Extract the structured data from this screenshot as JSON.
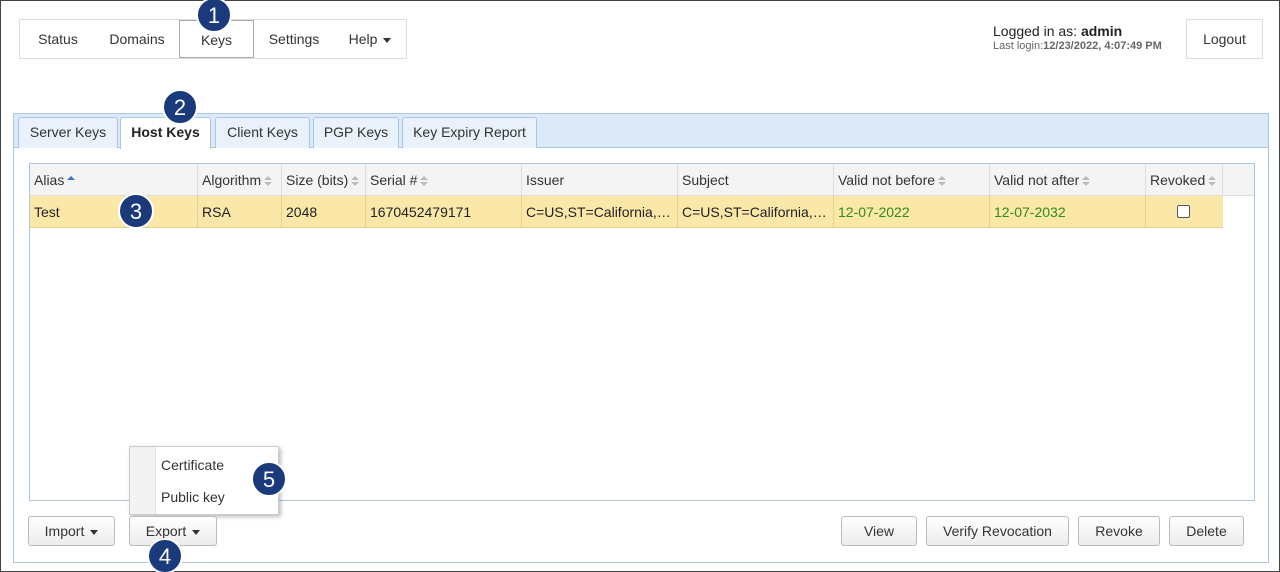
{
  "nav": {
    "items": [
      {
        "label": "Status"
      },
      {
        "label": "Domains"
      },
      {
        "label": "Keys"
      },
      {
        "label": "Settings"
      },
      {
        "label": "Help"
      }
    ]
  },
  "session": {
    "logged_in_prefix": "Logged in as: ",
    "user": "admin",
    "last_login_prefix": "Last login:",
    "last_login": "12/23/2022, 4:07:49 PM",
    "logout_label": "Logout"
  },
  "tabs": [
    {
      "label": "Server Keys"
    },
    {
      "label": "Host Keys"
    },
    {
      "label": "Client Keys"
    },
    {
      "label": "PGP Keys"
    },
    {
      "label": "Key Expiry Report"
    }
  ],
  "table": {
    "columns": [
      {
        "label": "Alias"
      },
      {
        "label": "Algorithm"
      },
      {
        "label": "Size (bits)"
      },
      {
        "label": "Serial #"
      },
      {
        "label": "Issuer"
      },
      {
        "label": "Subject"
      },
      {
        "label": "Valid not before"
      },
      {
        "label": "Valid not after"
      },
      {
        "label": "Revoked"
      }
    ],
    "rows": [
      {
        "alias": "Test",
        "algorithm": "RSA",
        "size": "2048",
        "serial": "1670452479171",
        "issuer": "C=US,ST=California,L=San Jose",
        "subject": "C=US,ST=California,L=San Jose",
        "valid_not_before": "12-07-2022",
        "valid_not_after": "12-07-2032",
        "revoked": false
      }
    ]
  },
  "export_menu": {
    "items": [
      {
        "label": "Certificate"
      },
      {
        "label": "Public key"
      }
    ]
  },
  "buttons": {
    "import": "Import",
    "export": "Export",
    "view": "View",
    "verify_revocation": "Verify Revocation",
    "revoke": "Revoke",
    "delete": "Delete"
  },
  "callouts": [
    "1",
    "2",
    "3",
    "4",
    "5"
  ],
  "colors": {
    "selected_row": "#fbe7a8",
    "date_text": "#2e8b1e",
    "callout_bg": "#1a3a7c",
    "tab_bar": "#dbe9f8"
  }
}
